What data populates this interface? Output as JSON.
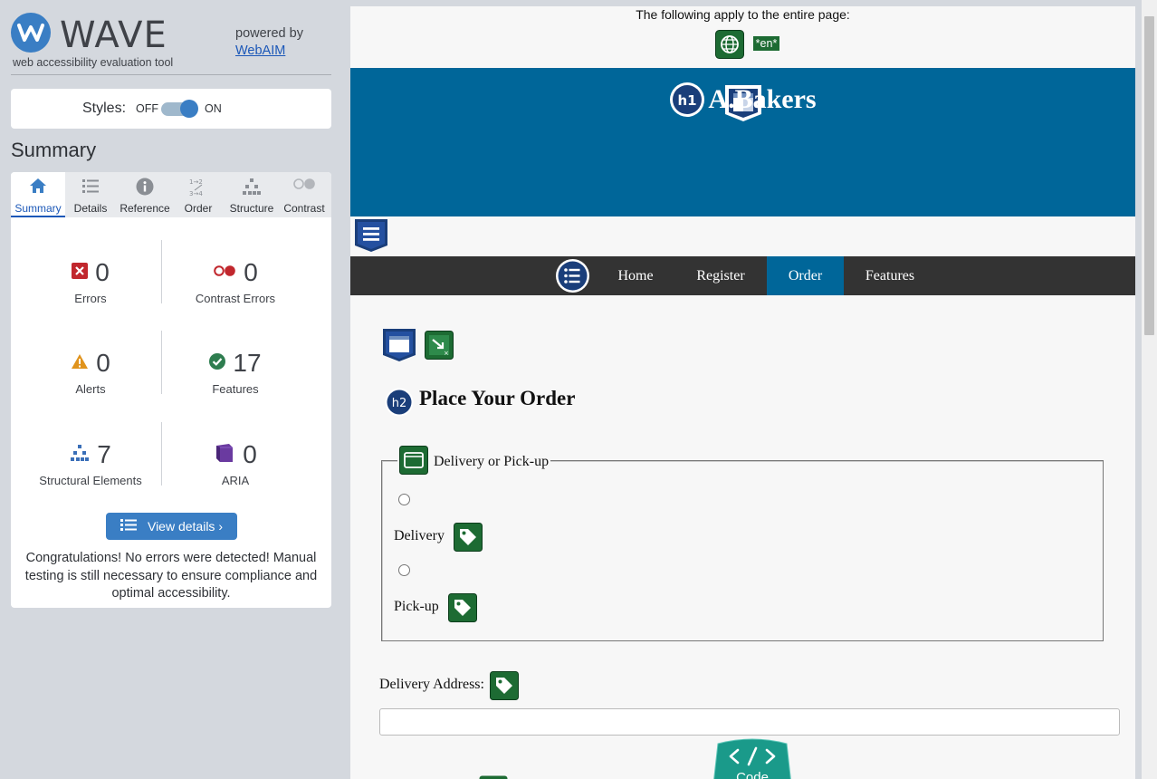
{
  "wave": {
    "logo_text": "WAVE",
    "tagline": "web accessibility evaluation tool",
    "powered_by": "powered by",
    "webaim_link": "WebAIM",
    "styles_label": "Styles:",
    "styles_off": "OFF",
    "styles_on": "ON",
    "styles_enabled": true,
    "summary_heading": "Summary",
    "tabs": [
      {
        "label": "Summary",
        "icon": "home-icon",
        "active": true
      },
      {
        "label": "Details",
        "icon": "list-icon"
      },
      {
        "label": "Reference",
        "icon": "info-icon"
      },
      {
        "label": "Order",
        "icon": "order-icon"
      },
      {
        "label": "Structure",
        "icon": "structure-icon"
      },
      {
        "label": "Contrast",
        "icon": "contrast-icon"
      }
    ],
    "stats": {
      "errors": {
        "count": "0",
        "label": "Errors"
      },
      "contrast_errors": {
        "count": "0",
        "label": "Contrast Errors"
      },
      "alerts": {
        "count": "0",
        "label": "Alerts"
      },
      "features": {
        "count": "17",
        "label": "Features"
      },
      "structural": {
        "count": "7",
        "label": "Structural Elements"
      },
      "aria": {
        "count": "0",
        "label": "ARIA"
      }
    },
    "view_details_label": "View details ›",
    "congrats_text": "Congratulations! No errors were detected! Manual testing is still necessary to ensure compliance and optimal accessibility."
  },
  "preview": {
    "apply_text": "The following apply to the entire page:",
    "lang_badge": "*en*",
    "h1_badge": "h1",
    "site_title": "A.Bakers",
    "nav": [
      {
        "label": "Home"
      },
      {
        "label": "Register"
      },
      {
        "label": "Order",
        "active": true
      },
      {
        "label": "Features"
      }
    ],
    "h2_badge": "h2",
    "order_heading": "Place Your Order",
    "fieldset_legend": "Delivery or Pick-up",
    "radio_delivery_label": "Delivery",
    "radio_pickup_label": "Pick-up",
    "address_label": "Delivery Address:",
    "address_value": "",
    "code_tab_label": "Code"
  },
  "colors": {
    "wave_blue": "#3a7ec4",
    "header_blue": "#006699",
    "nav_dark": "#333333",
    "feature_green": "#1d6b33",
    "structure_navy": "#1a3e7a",
    "error_red": "#c1272d",
    "alert_orange": "#e0931c",
    "aria_purple": "#6a3aa0"
  }
}
